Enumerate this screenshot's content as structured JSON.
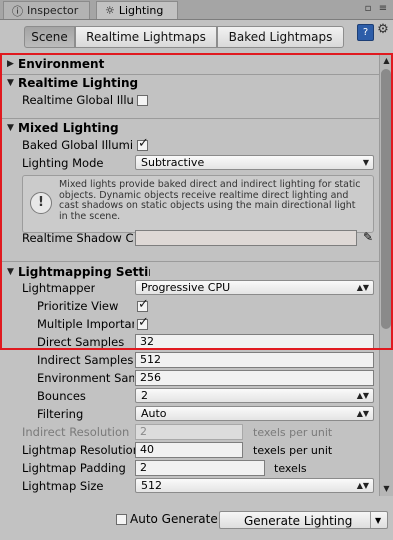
{
  "tabs": {
    "inspector": "Inspector",
    "lighting": "Lighting"
  },
  "toolbar": {
    "scene": "Scene",
    "realtime_lightmaps": "Realtime Lightmaps",
    "baked_lightmaps": "Baked Lightmaps"
  },
  "environment": {
    "header": "Environment"
  },
  "realtime": {
    "header": "Realtime Lighting",
    "global_illum_label": "Realtime Global Illu",
    "global_illum_checked": false
  },
  "mixed": {
    "header": "Mixed Lighting",
    "baked_gi_label": "Baked Global Illumi",
    "baked_gi_checked": true,
    "lighting_mode_label": "Lighting Mode",
    "lighting_mode_value": "Subtractive",
    "info_text": "Mixed lights provide baked direct and indirect lighting for static objects. Dynamic objects receive realtime direct lighting and cast shadows on static objects using the main directional light in the scene.",
    "shadow_color_label": "Realtime Shadow C"
  },
  "lightmapping": {
    "header": "Lightmapping Settin",
    "lightmapper_label": "Lightmapper",
    "lightmapper_value": "Progressive CPU",
    "prioritize_view_label": "Prioritize View",
    "prioritize_view_checked": true,
    "multiple_importance_label": "Multiple Importan",
    "multiple_importance_checked": true,
    "direct_samples_label": "Direct Samples",
    "direct_samples_value": "32",
    "indirect_samples_label": "Indirect Samples",
    "indirect_samples_value": "512",
    "environment_samples_label": "Environment Sam",
    "environment_samples_value": "256",
    "bounces_label": "Bounces",
    "bounces_value": "2",
    "filtering_label": "Filtering",
    "filtering_value": "Auto",
    "indirect_resolution_label": "Indirect Resolution",
    "indirect_resolution_value": "2",
    "indirect_resolution_unit": "texels per unit",
    "lightmap_resolution_label": "Lightmap Resolution",
    "lightmap_resolution_value": "40",
    "lightmap_resolution_unit": "texels per unit",
    "lightmap_padding_label": "Lightmap Padding",
    "lightmap_padding_value": "2",
    "lightmap_padding_unit": "texels",
    "lightmap_size_label": "Lightmap Size",
    "lightmap_size_value": "512"
  },
  "bottom": {
    "auto_generate_label": "Auto Generate",
    "auto_generate_checked": false,
    "generate_label": "Generate Lighting"
  },
  "colors": {
    "highlight": "#e0191f",
    "shadow_color_swatch": "#ded8d5",
    "help_icon": "#2d5da8"
  },
  "icons": [
    "inspector-icon",
    "lighting-icon",
    "lock-icon",
    "menu-icon",
    "help-icon",
    "gear-icon",
    "info-icon",
    "eyedropper-icon",
    "chevron-down-icon"
  ]
}
